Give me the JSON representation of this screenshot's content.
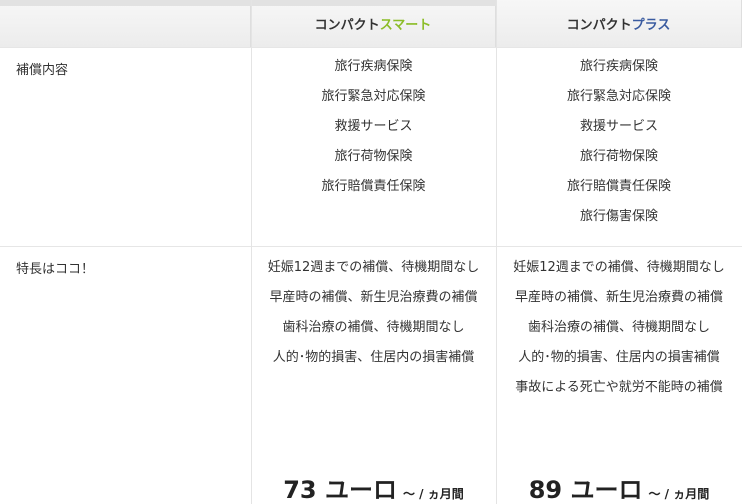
{
  "header": {
    "plans": [
      {
        "prefix": "コンパクト",
        "accent": "スマート",
        "accent_color": "#8cbd28"
      },
      {
        "prefix": "コンパクト",
        "accent": "プラス",
        "accent_color": "#3a5ba0"
      }
    ]
  },
  "rows": {
    "coverage": {
      "label": "補償内容",
      "plan_a": [
        "旅行疾病保険",
        "旅行緊急対応保険",
        "救援サービス",
        "旅行荷物保険",
        "旅行賠償責任保険"
      ],
      "plan_b": [
        "旅行疾病保険",
        "旅行緊急対応保険",
        "救援サービス",
        "旅行荷物保険",
        "旅行賠償責任保険",
        "旅行傷害保険"
      ]
    },
    "features": {
      "label": "特長はココ！",
      "plan_a": [
        "妊娠12週までの補償、待機期間なし",
        "早産時の補償、新生児治療費の補償",
        "歯科治療の補償、待機期間なし",
        "人的･物的損害、住居内の損害補償"
      ],
      "plan_b": [
        "妊娠12週までの補償、待機期間なし",
        "早産時の補償、新生児治療費の補償",
        "歯科治療の補償、待機期間なし",
        "人的･物的損害、住居内の損害補償",
        "事故による死亡や就労不能時の補償"
      ]
    }
  },
  "prices": [
    {
      "amount": "73 ユーロ",
      "unit": "～ / ヵ月間"
    },
    {
      "amount": "89 ユーロ",
      "unit": "～ / ヵ月間"
    }
  ]
}
